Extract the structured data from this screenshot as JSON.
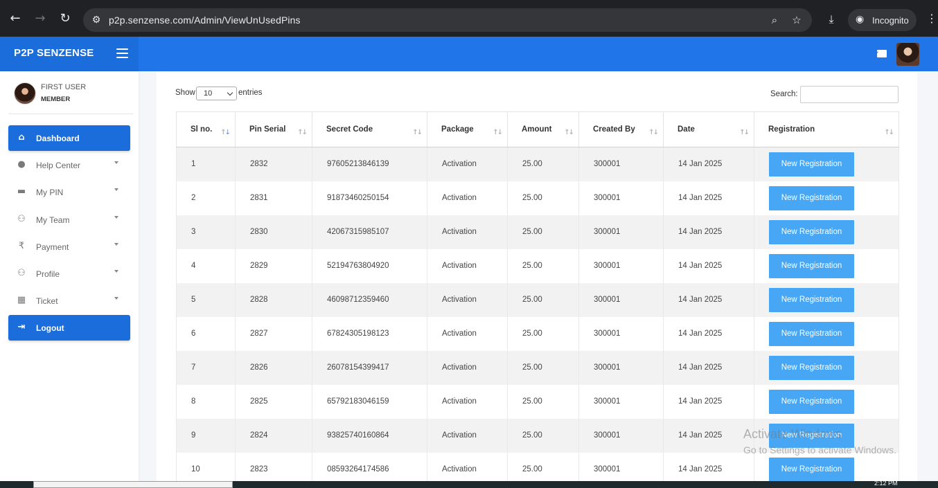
{
  "browser": {
    "url_host": "p2p.senzense.com",
    "url_path": "/Admin/ViewUnUsedPins",
    "profile_label": "Incognito"
  },
  "app": {
    "brand": "P2P SENZENSE"
  },
  "user": {
    "name": "FIRST USER",
    "role": "MEMBER"
  },
  "sidebar": {
    "items": [
      {
        "label": "Dashboard",
        "icon": "home-icon"
      },
      {
        "label": "Help Center",
        "icon": "user-icon"
      },
      {
        "label": "My PIN",
        "icon": "wallet-icon"
      },
      {
        "label": "My Team",
        "icon": "users-icon"
      },
      {
        "label": "Payment",
        "icon": "rupee-icon"
      },
      {
        "label": "Profile",
        "icon": "users-cog-icon"
      },
      {
        "label": "Ticket",
        "icon": "table-icon"
      },
      {
        "label": "Logout",
        "icon": "sign-out-icon"
      }
    ]
  },
  "table_controls": {
    "show_label": "Show",
    "entries_value": "10",
    "entries_label": "entries",
    "search_label": "Search:"
  },
  "table": {
    "columns": [
      "Sl no.",
      "Pin Serial",
      "Secret Code",
      "Package",
      "Amount",
      "Created By",
      "Date",
      "Registration"
    ],
    "button_label": "New Registration",
    "rows": [
      [
        "1",
        "2832",
        "97605213846139",
        "Activation",
        "25.00",
        "300001",
        "14 Jan 2025"
      ],
      [
        "2",
        "2831",
        "91873460250154",
        "Activation",
        "25.00",
        "300001",
        "14 Jan 2025"
      ],
      [
        "3",
        "2830",
        "42067315985107",
        "Activation",
        "25.00",
        "300001",
        "14 Jan 2025"
      ],
      [
        "4",
        "2829",
        "52194763804920",
        "Activation",
        "25.00",
        "300001",
        "14 Jan 2025"
      ],
      [
        "5",
        "2828",
        "46098712359460",
        "Activation",
        "25.00",
        "300001",
        "14 Jan 2025"
      ],
      [
        "6",
        "2827",
        "67824305198123",
        "Activation",
        "25.00",
        "300001",
        "14 Jan 2025"
      ],
      [
        "7",
        "2826",
        "26078154399417",
        "Activation",
        "25.00",
        "300001",
        "14 Jan 2025"
      ],
      [
        "8",
        "2825",
        "65792183046159",
        "Activation",
        "25.00",
        "300001",
        "14 Jan 2025"
      ],
      [
        "9",
        "2824",
        "93825740160864",
        "Activation",
        "25.00",
        "300001",
        "14 Jan 2025"
      ],
      [
        "10",
        "2823",
        "08593264174586",
        "Activation",
        "25.00",
        "300001",
        "14 Jan 2025"
      ]
    ]
  },
  "watermark": {
    "line1": "Activate Windows",
    "line2": "Go to Settings to activate Windows."
  },
  "taskbar": {
    "clock": "2:12 PM"
  },
  "colors": {
    "header_blue": "#2075e8",
    "brand_blue": "#1b6ddb",
    "button_blue": "#47a7f5"
  }
}
